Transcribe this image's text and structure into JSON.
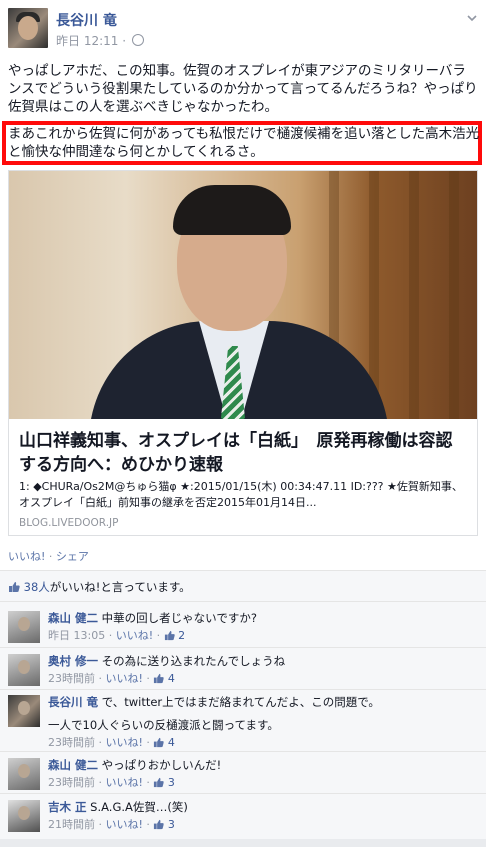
{
  "post": {
    "author": "長谷川 竜",
    "time": "昨日 12:11",
    "dot": "·",
    "text_1": "やっぱしアホだ、この知事。佐賀のオスプレイが東アジアのミリタリーバランスでどういう役割果たしているのか分かって言ってるんだろうね？やっぱり佐賀県はこの人を選ぶべきじゃなかったわ。",
    "text_2": "まあこれから佐賀に何があっても私恨だけで樋渡候補を追い落とした高木浩光と愉快な仲間達なら何とかしてくれるさ。"
  },
  "link": {
    "title": "山口祥義知事、オスプレイは「白紙」　原発再稼働は容認する方向へ：めひかり速報",
    "desc": "1: ◆CHURa/Os2M@ちゅら猫φ ★:2015/01/15(木) 00:34:47.11 ID:??? ★佐賀新知事、オスプレイ「白紙」前知事の継承を否定2015年01月14日...",
    "domain": "BLOG.LIVEDOOR.JP"
  },
  "actions": {
    "like": "いいね!",
    "sep": "·",
    "share": "シェア"
  },
  "likes": {
    "count": "38人",
    "suffix": "がいいね!と言っています。"
  },
  "comments": [
    {
      "name": "森山 健二",
      "text": "中華の回し者じゃないですか?",
      "time": "昨日 13:05",
      "like": "いいね!",
      "count": "2"
    },
    {
      "name": "奥村 修一",
      "text": "その為に送り込まれたんでしょうね",
      "time": "23時間前",
      "like": "いいね!",
      "count": "4"
    },
    {
      "name": "長谷川 竜",
      "text": "で、twitter上ではまだ絡まれてんだよ、この問題で。",
      "text2": "一人で10人ぐらいの反樋渡派と闘ってます。",
      "time": "23時間前",
      "like": "いいね!",
      "count": "4"
    },
    {
      "name": "森山 健二",
      "text": "やっぱりおかしいんだ!",
      "time": "23時間前",
      "like": "いいね!",
      "count": "3"
    },
    {
      "name": "吉木 正",
      "text": "S.A.G.A佐賀…(笑)",
      "time": "21時間前",
      "like": "いいね!",
      "count": "3"
    }
  ]
}
